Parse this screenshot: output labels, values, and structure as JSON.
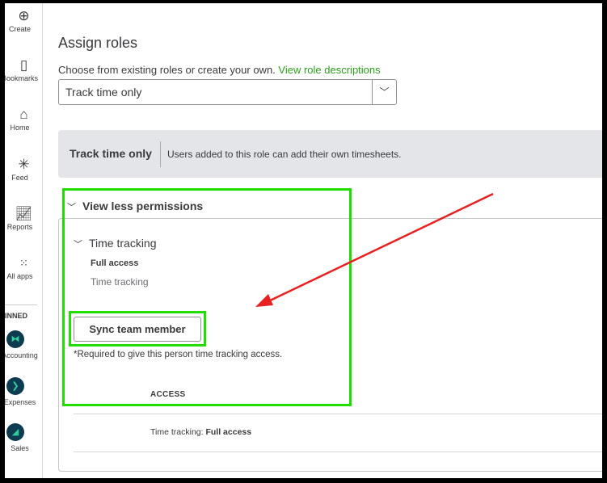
{
  "sidebar": {
    "items": [
      {
        "label": "Create",
        "icon": "plus-circle-icon"
      },
      {
        "label": "Bookmarks",
        "icon": "bookmark-icon"
      },
      {
        "label": "Home",
        "icon": "home-icon"
      },
      {
        "label": "Feed",
        "icon": "feed-icon"
      },
      {
        "label": "Reports",
        "icon": "chart-icon"
      },
      {
        "label": "All apps",
        "icon": "grid-icon"
      }
    ],
    "pinned_label": "PINNED",
    "pinned": [
      {
        "label": "Accounting"
      },
      {
        "label": "Expenses"
      },
      {
        "label": "Sales"
      }
    ]
  },
  "main": {
    "title": "Assign roles",
    "subtitle": "Choose from existing roles or create your own.",
    "link": "View role descriptions",
    "role_select": "Track time only",
    "banner": {
      "title": "Track time only",
      "description": "Users added to this role can add their own timesheets."
    },
    "toggle": "View less permissions",
    "section": {
      "title": "Time tracking",
      "level": "Full access",
      "item": "Time tracking"
    },
    "sync_button": "Sync team member",
    "required_note": "*Required to give this person time tracking access.",
    "table": {
      "header": "ACCESS",
      "row_label": "Time tracking:",
      "row_value": "Full access"
    }
  },
  "colors": {
    "highlight": "#22dd00",
    "arrow": "#e82020",
    "brand": "#2ca01c"
  }
}
